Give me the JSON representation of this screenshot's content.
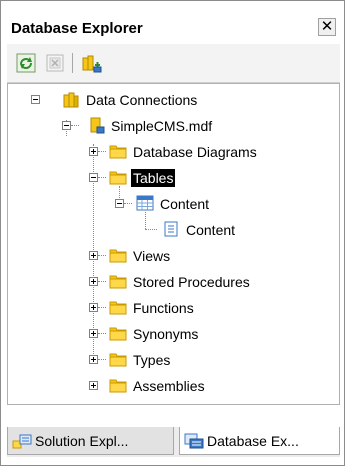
{
  "window": {
    "title": "Database Explorer",
    "close_glyph": "✕"
  },
  "toolbar": {
    "buttons": [
      {
        "name": "refresh-icon",
        "interactable": true
      },
      {
        "name": "stop-icon",
        "interactable": true
      },
      {
        "name": "connect-to-database-icon",
        "interactable": true
      }
    ]
  },
  "tree": {
    "data_connections": "Data Connections",
    "db_file": "SimpleCMS.mdf",
    "database_diagrams": "Database Diagrams",
    "tables": "Tables",
    "content_table": "Content",
    "content_column": "Content",
    "views": "Views",
    "stored_procedures": "Stored Procedures",
    "functions": "Functions",
    "synonyms": "Synonyms",
    "types": "Types",
    "assemblies": "Assemblies"
  },
  "tabs": {
    "solution": "Solution Expl...",
    "database": "Database Ex..."
  },
  "colors": {
    "folder": "#f5c518",
    "folder_dark": "#d9a400",
    "selected_bg": "#000000",
    "table_blue": "#3a78c8"
  }
}
